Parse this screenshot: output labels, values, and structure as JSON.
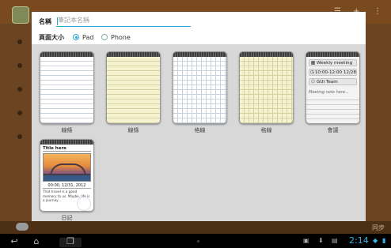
{
  "dialog": {
    "name_label": "名稱",
    "name_placeholder": "筆記本名稱",
    "size_label": "頁面大小",
    "size_options": [
      {
        "label": "Pad",
        "selected": true
      },
      {
        "label": "Phone",
        "selected": false
      }
    ]
  },
  "templates": [
    {
      "caption": "線條",
      "style": "lined-white"
    },
    {
      "caption": "線條",
      "style": "lined-yellow"
    },
    {
      "caption": "格線",
      "style": "grid-white"
    },
    {
      "caption": "格線",
      "style": "grid-yellow"
    },
    {
      "caption": "會議",
      "style": "meeting"
    },
    {
      "caption": "日記",
      "style": "diary"
    }
  ],
  "meeting_card": {
    "title": "Weekly meeting",
    "time": "10:00-12:00 12/28",
    "team": "GUI Team",
    "note": "Meeting note here..."
  },
  "diary_card": {
    "title": "Title here",
    "date": "00:00, 12/31, 2012",
    "text": "That travel is a good memory to us. Maybe, life is a journey..."
  },
  "background_app": {
    "sync_label": "同步"
  },
  "system_bar": {
    "time": "2:14"
  },
  "colors": {
    "accent": "#2aa6d6",
    "clock": "#33b5e5"
  }
}
